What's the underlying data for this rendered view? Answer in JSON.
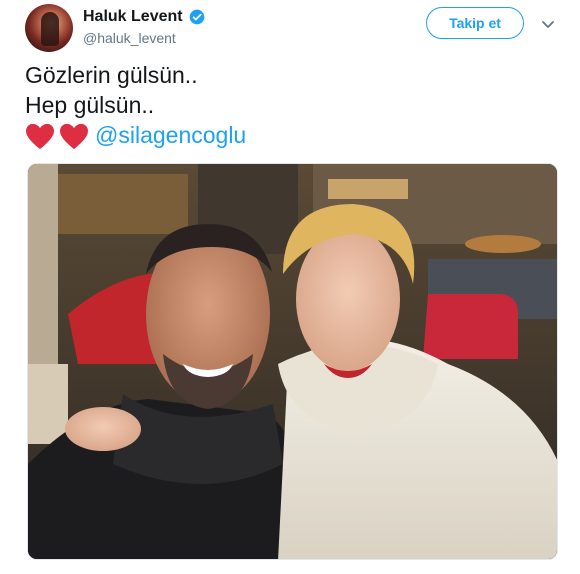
{
  "author": {
    "name": "Haluk Levent",
    "handle": "@haluk_levent",
    "verified": true
  },
  "actions": {
    "follow_label": "Takip et"
  },
  "tweet": {
    "line1": "Gözlerin gülsün..",
    "line2": "Hep gülsün..",
    "mention": "@silagencoglu"
  },
  "icons": {
    "verified": "verified-badge-icon",
    "caret": "chevron-down-icon",
    "heart": "red-heart-emoji"
  },
  "colors": {
    "accent": "#1da1f2",
    "text": "#14171a",
    "secondary": "#657786",
    "heart": "#dd2e44"
  }
}
